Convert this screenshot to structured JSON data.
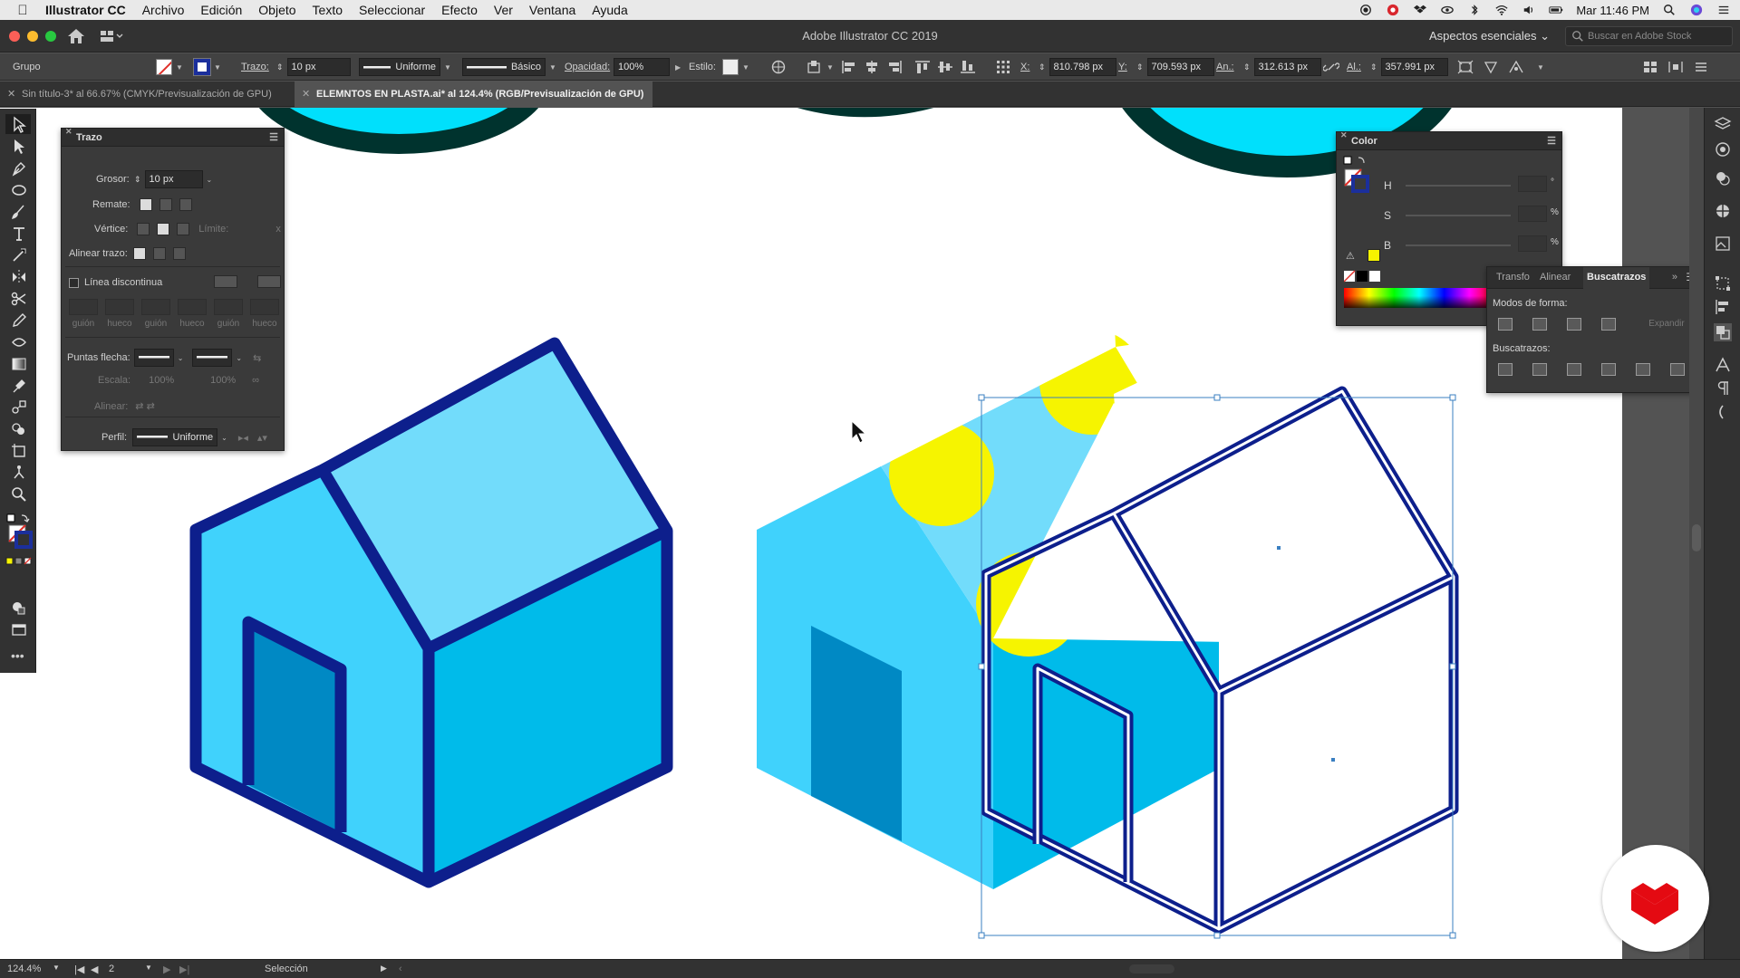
{
  "menubar": {
    "app_name": "Illustrator CC",
    "items": [
      "Archivo",
      "Edición",
      "Objeto",
      "Texto",
      "Seleccionar",
      "Efecto",
      "Ver",
      "Ventana",
      "Ayuda"
    ],
    "clock": "Mar 11:46 PM"
  },
  "window": {
    "title": "Adobe Illustrator CC 2019",
    "workspace": "Aspectos esenciales",
    "stock_placeholder": "Buscar en Adobe Stock"
  },
  "control": {
    "selection_type": "Grupo",
    "stroke_label": "Trazo:",
    "stroke_weight": "10 px",
    "stroke_profile": "Uniforme",
    "brush": "Básico",
    "opacity_label": "Opacidad:",
    "opacity": "100%",
    "style_label": "Estilo:",
    "x_label": "X:",
    "x": "810.798 px",
    "y_label": "Y:",
    "y": "709.593 px",
    "w_label": "An.:",
    "w": "312.613 px",
    "h_label": "Al.:",
    "h": "357.991 px"
  },
  "tabs": [
    {
      "label": "Sin título-3* al 66.67% (CMYK/Previsualización de GPU)",
      "active": false
    },
    {
      "label": "ELEMNTOS EN PLASTA.ai* al 124.4% (RGB/Previsualización de GPU)",
      "active": true
    }
  ],
  "trazo_panel": {
    "title": "Trazo",
    "grosor_label": "Grosor:",
    "grosor": "10 px",
    "remate_label": "Remate:",
    "vertice_label": "Vértice:",
    "limite_label": "Límite:",
    "limite_unit": "x",
    "alinear_label": "Alinear trazo:",
    "dash_label": "Línea discontinua",
    "dash_fields": [
      "guión",
      "hueco",
      "guión",
      "hueco",
      "guión",
      "hueco"
    ],
    "puntas_label": "Puntas flecha:",
    "escala_label": "Escala:",
    "escala_1": "100%",
    "escala_2": "100%",
    "alinear2_label": "Alinear:",
    "perfil_label": "Perfil:",
    "perfil": "Uniforme"
  },
  "color_panel": {
    "title": "Color",
    "h_label": "H",
    "h_unit": "°",
    "s_label": "S",
    "s_unit": "%",
    "b_label": "B",
    "b_unit": "%"
  },
  "pathfinder_panel": {
    "tabs": [
      "Transfo",
      "Alinear",
      "Buscatrazos"
    ],
    "shape_modes_label": "Modos de forma:",
    "expand_label": "Expandir",
    "pathfinders_label": "Buscatrazos:"
  },
  "status": {
    "zoom": "124.4%",
    "artboard": "2",
    "tool": "Selección"
  },
  "colors": {
    "outline": "#0d1f8c",
    "roof_light": "#72dcfb",
    "wall_light": "#40d2fc",
    "wall_front": "#00bbea",
    "door": "#0089c4",
    "yellow": "#f6f400",
    "circle_top": "#00e0fc",
    "circle_edge": "#00332e",
    "selection": "#3a7fc1",
    "brand_red": "#e40a12"
  }
}
